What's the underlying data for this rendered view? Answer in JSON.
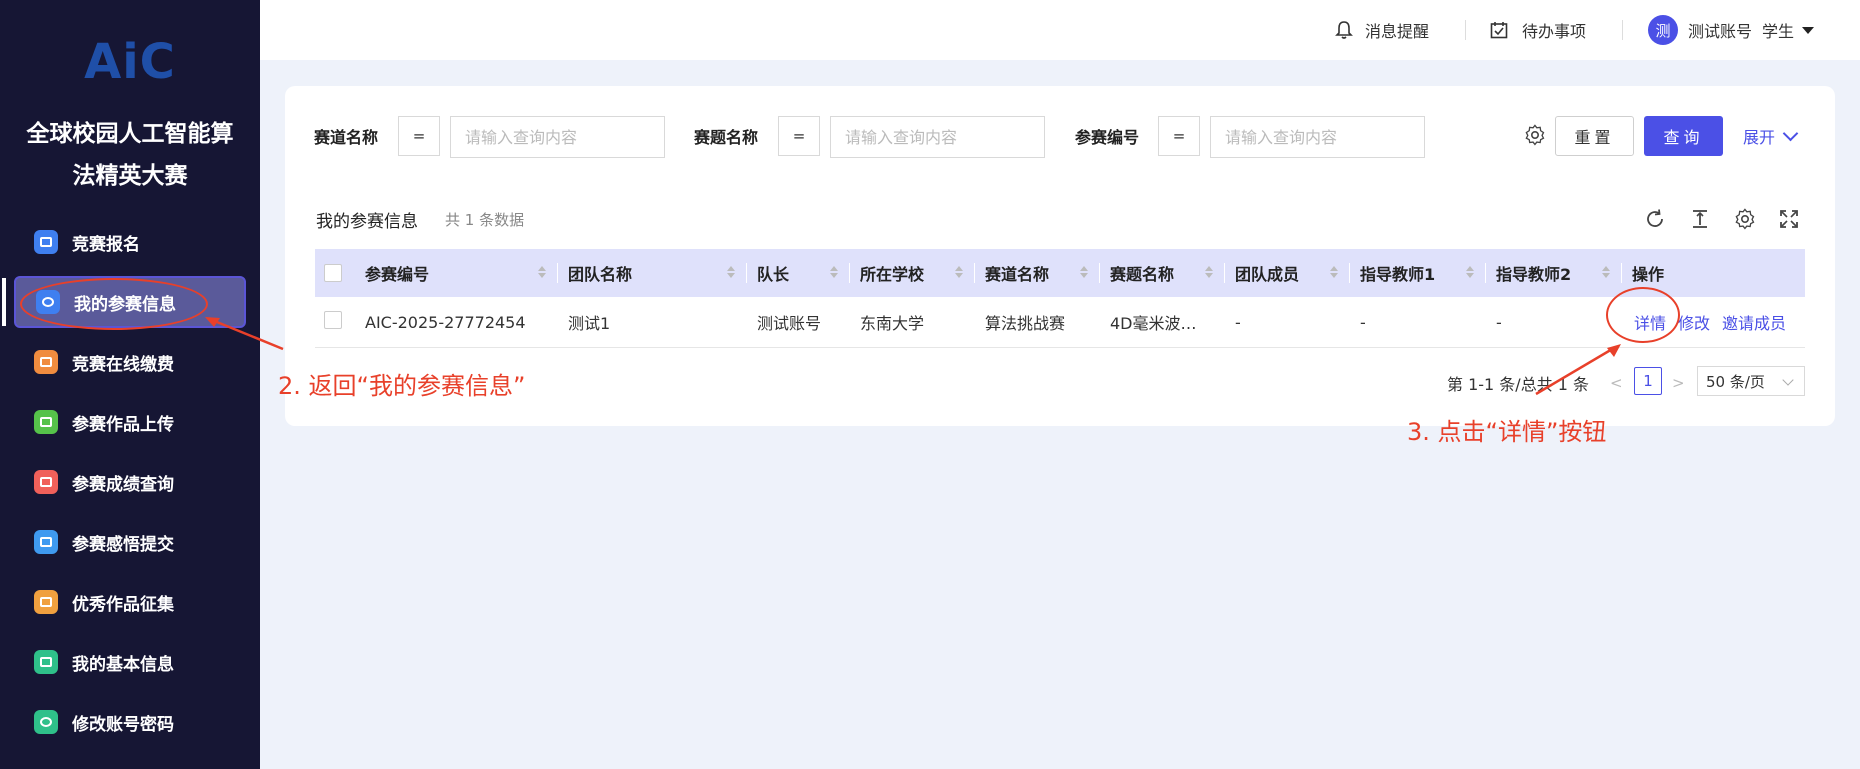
{
  "sidebar": {
    "logo": "AiC",
    "title": "全球校园人工智能算法精英大赛",
    "items": [
      {
        "label": "竞赛报名",
        "color": "#3f7ff0"
      },
      {
        "label": "我的参赛信息",
        "color": "#3f7ff0"
      },
      {
        "label": "竞赛在线缴费",
        "color": "#f08c3f"
      },
      {
        "label": "参赛作品上传",
        "color": "#56c24a"
      },
      {
        "label": "参赛成绩查询",
        "color": "#f0605a"
      },
      {
        "label": "参赛感悟提交",
        "color": "#3f9af0"
      },
      {
        "label": "优秀作品征集",
        "color": "#f0a03f"
      },
      {
        "label": "我的基本信息",
        "color": "#2fc08a"
      },
      {
        "label": "修改账号密码",
        "color": "#2fc08a"
      }
    ]
  },
  "topbar": {
    "notifications": "消息提醒",
    "todos": "待办事项",
    "avatar_char": "测",
    "username": "测试账号",
    "role": "学生"
  },
  "filters": {
    "f1_label": "赛道名称",
    "f2_label": "赛题名称",
    "f3_label": "参赛编号",
    "operator": "=",
    "placeholder": "请输入查询内容",
    "reset": "重置",
    "query": "查询",
    "expand": "展开"
  },
  "section": {
    "title": "我的参赛信息",
    "count": "共 1 条数据"
  },
  "table": {
    "columns": [
      "参赛编号",
      "团队名称",
      "队长",
      "所在学校",
      "赛道名称",
      "赛题名称",
      "团队成员",
      "指导教师1",
      "指导教师2",
      "操作"
    ],
    "rows": [
      {
        "id": "AIC-2025-27772454",
        "team": "测试1",
        "captain": "测试账号",
        "school": "东南大学",
        "track": "算法挑战赛",
        "problem": "4D毫米波…",
        "members": "-",
        "teacher1": "-",
        "teacher2": "-",
        "actions": [
          "详情",
          "修改",
          "邀请成员"
        ]
      }
    ]
  },
  "pagination": {
    "summary": "第 1-1 条/总共 1 条",
    "prev": "<",
    "page": "1",
    "next": ">",
    "page_size": "50 条/页"
  },
  "annotations": {
    "step2": "2. 返回“我的参赛信息”",
    "step3": "3. 点击“详情”按钮",
    "color": "#e8402a"
  }
}
